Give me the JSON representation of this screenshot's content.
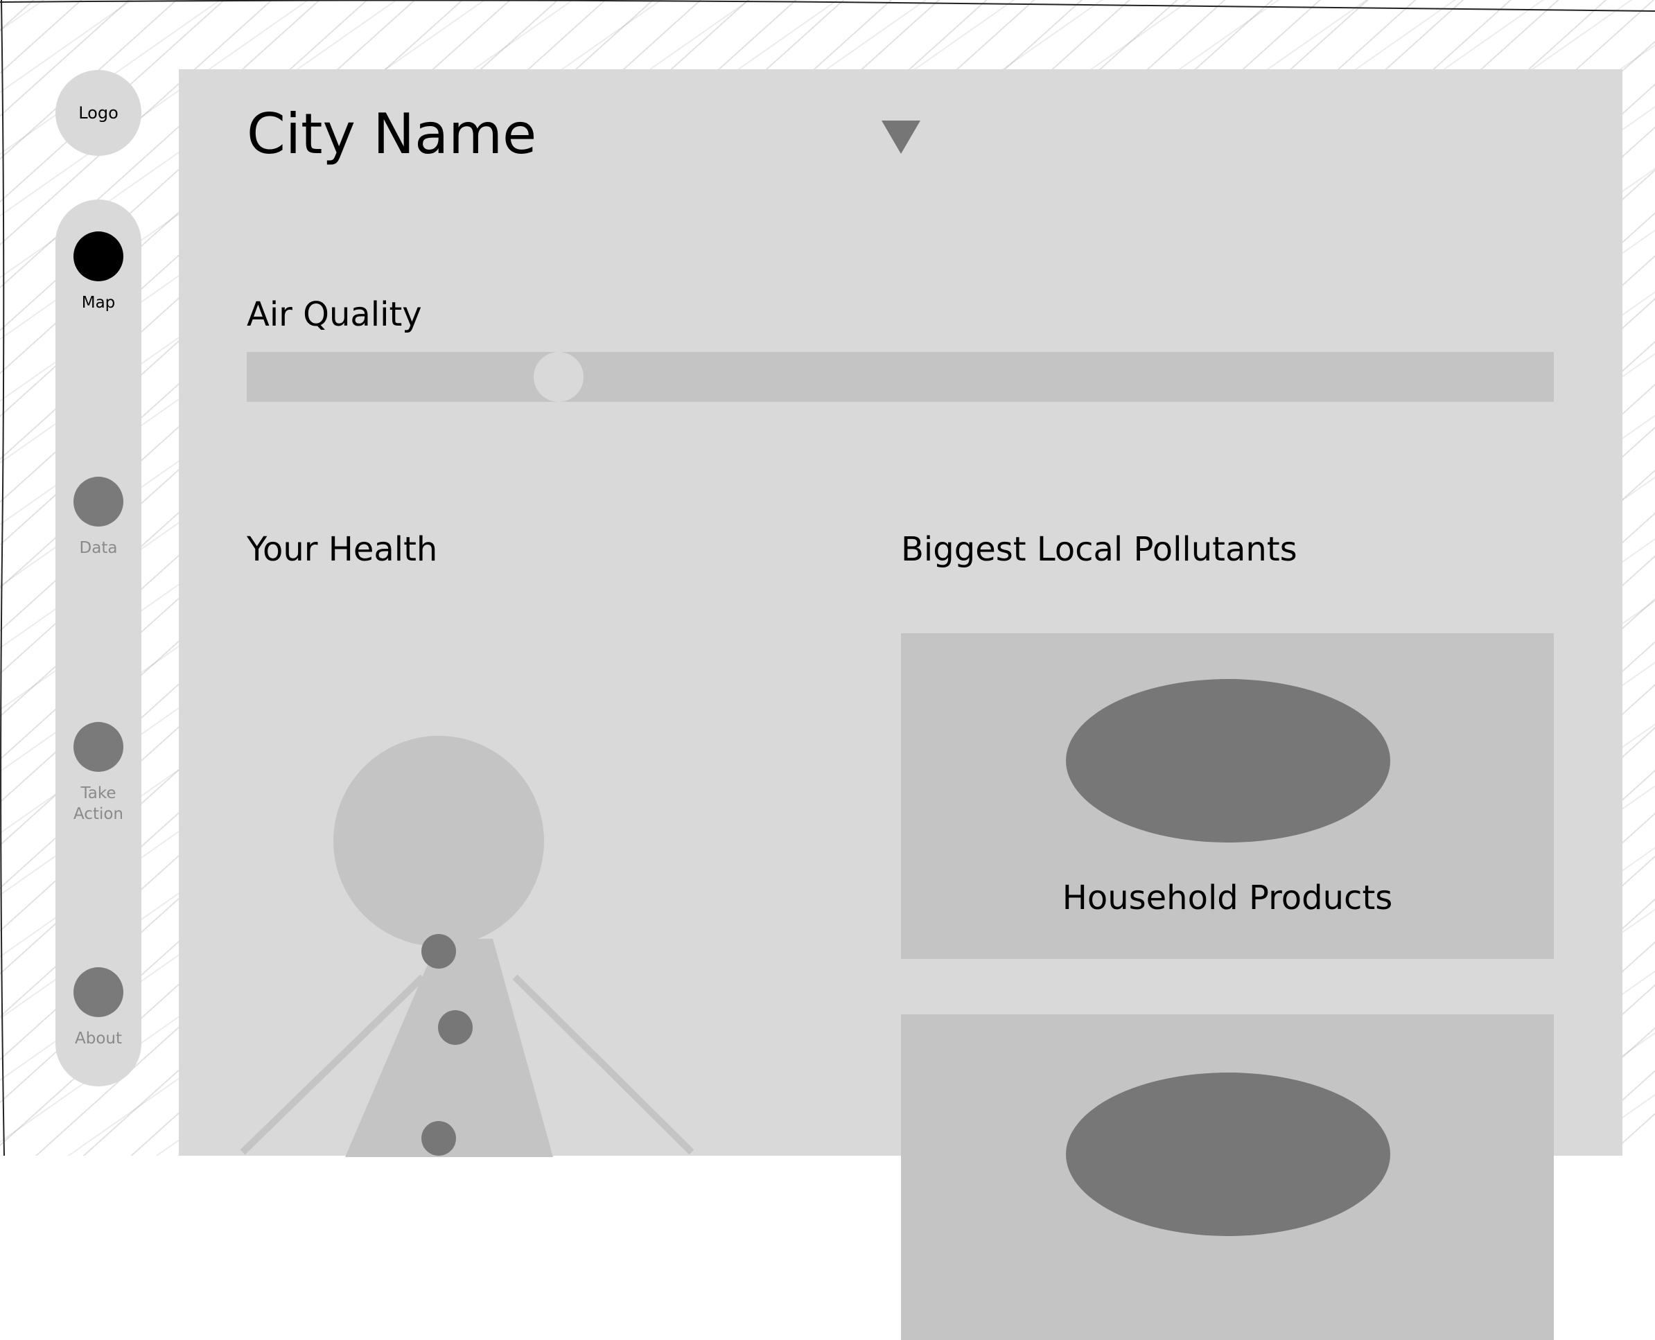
{
  "sidebar": {
    "logo": "Logo",
    "items": [
      {
        "label": "Map",
        "active": true
      },
      {
        "label": "Data",
        "active": false
      },
      {
        "label": "Take Action",
        "active": false
      },
      {
        "label": "About",
        "active": false
      }
    ]
  },
  "header": {
    "city_name": "City Name"
  },
  "air_quality": {
    "heading": "Air Quality",
    "level": 0.228
  },
  "health": {
    "heading": "Your Health"
  },
  "pollutants": {
    "heading": "Biggest Local Pollutants",
    "items": [
      {
        "label": "Household Products"
      },
      {
        "label": ""
      }
    ]
  },
  "colors": {
    "panel": "#d9d9d9",
    "track": "#c4c4c4",
    "active_nav": "#000000",
    "inactive_nav": "#7a7a7a"
  }
}
